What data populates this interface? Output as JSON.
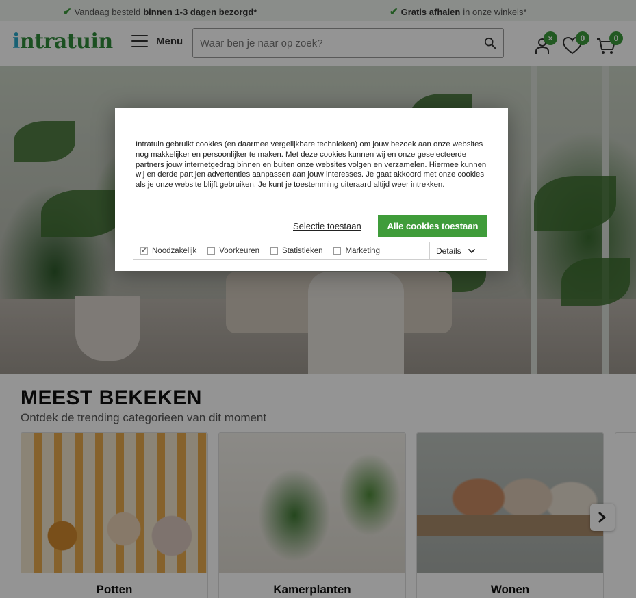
{
  "usp_bar": {
    "item1": {
      "text": "Vandaag besteld",
      "bold": "binnen 1-3 dagen bezorgd*"
    },
    "item2": {
      "bold": "Gratis afhalen",
      "text": "in onze winkels*"
    }
  },
  "header": {
    "logo": "intratuin",
    "menu_label": "Menu",
    "search_placeholder": "Waar ben je naar op zoek?",
    "wishlist_count": "0",
    "cart_count": "0",
    "account_badge": "×"
  },
  "section": {
    "title": "MEEST BEKEKEN",
    "subtitle": "Ontdek de trending categorieen van dit moment",
    "cards": [
      {
        "label": "Potten"
      },
      {
        "label": "Kamerplanten"
      },
      {
        "label": "Wonen"
      }
    ]
  },
  "cookie_modal": {
    "body": "Intratuin gebruikt cookies (en daarmee vergelijkbare technieken) om jouw bezoek aan onze websites nog makkelijker en persoonlijker te maken. Met deze cookies kunnen wij en onze geselecteerde partners jouw internetgedrag binnen en buiten onze websites volgen en verzamelen. Hiermee kunnen wij en derde partijen advertenties aanpassen aan jouw interesses. Je gaat akkoord met onze cookies als je onze website blijft gebruiken. Je kunt je toestemming uiteraard altijd weer intrekken.",
    "selection_button": "Selectie toestaan",
    "accept_all_button": "Alle cookies toestaan",
    "options": [
      {
        "label": "Noodzakelijk",
        "checked": true
      },
      {
        "label": "Voorkeuren",
        "checked": false
      },
      {
        "label": "Statistieken",
        "checked": false
      },
      {
        "label": "Marketing",
        "checked": false
      }
    ],
    "details_label": "Details"
  },
  "colors": {
    "brand_green": "#3f9c3a",
    "logo_blue": "#2aa7c9"
  }
}
